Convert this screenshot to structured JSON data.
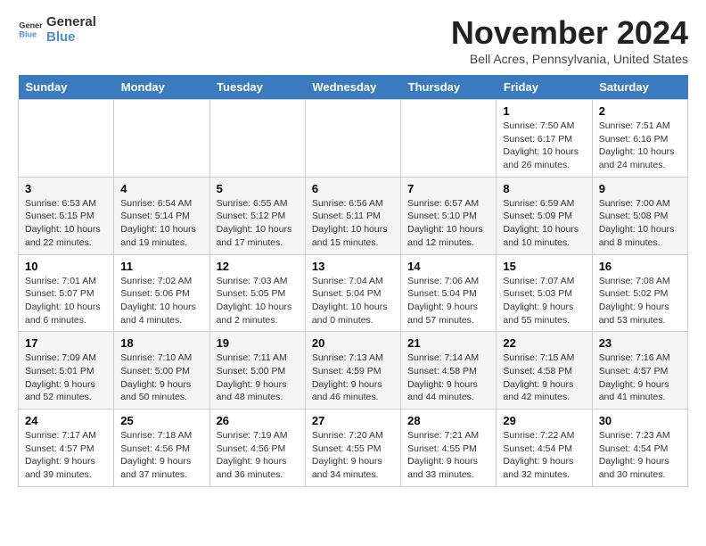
{
  "logo": {
    "text1": "General",
    "text2": "Blue"
  },
  "title": "November 2024",
  "subtitle": "Bell Acres, Pennsylvania, United States",
  "days_of_week": [
    "Sunday",
    "Monday",
    "Tuesday",
    "Wednesday",
    "Thursday",
    "Friday",
    "Saturday"
  ],
  "weeks": [
    [
      {
        "day": "",
        "info": ""
      },
      {
        "day": "",
        "info": ""
      },
      {
        "day": "",
        "info": ""
      },
      {
        "day": "",
        "info": ""
      },
      {
        "day": "",
        "info": ""
      },
      {
        "day": "1",
        "info": "Sunrise: 7:50 AM\nSunset: 6:17 PM\nDaylight: 10 hours\nand 26 minutes."
      },
      {
        "day": "2",
        "info": "Sunrise: 7:51 AM\nSunset: 6:16 PM\nDaylight: 10 hours\nand 24 minutes."
      }
    ],
    [
      {
        "day": "3",
        "info": "Sunrise: 6:53 AM\nSunset: 5:15 PM\nDaylight: 10 hours\nand 22 minutes."
      },
      {
        "day": "4",
        "info": "Sunrise: 6:54 AM\nSunset: 5:14 PM\nDaylight: 10 hours\nand 19 minutes."
      },
      {
        "day": "5",
        "info": "Sunrise: 6:55 AM\nSunset: 5:12 PM\nDaylight: 10 hours\nand 17 minutes."
      },
      {
        "day": "6",
        "info": "Sunrise: 6:56 AM\nSunset: 5:11 PM\nDaylight: 10 hours\nand 15 minutes."
      },
      {
        "day": "7",
        "info": "Sunrise: 6:57 AM\nSunset: 5:10 PM\nDaylight: 10 hours\nand 12 minutes."
      },
      {
        "day": "8",
        "info": "Sunrise: 6:59 AM\nSunset: 5:09 PM\nDaylight: 10 hours\nand 10 minutes."
      },
      {
        "day": "9",
        "info": "Sunrise: 7:00 AM\nSunset: 5:08 PM\nDaylight: 10 hours\nand 8 minutes."
      }
    ],
    [
      {
        "day": "10",
        "info": "Sunrise: 7:01 AM\nSunset: 5:07 PM\nDaylight: 10 hours\nand 6 minutes."
      },
      {
        "day": "11",
        "info": "Sunrise: 7:02 AM\nSunset: 5:06 PM\nDaylight: 10 hours\nand 4 minutes."
      },
      {
        "day": "12",
        "info": "Sunrise: 7:03 AM\nSunset: 5:05 PM\nDaylight: 10 hours\nand 2 minutes."
      },
      {
        "day": "13",
        "info": "Sunrise: 7:04 AM\nSunset: 5:04 PM\nDaylight: 10 hours\nand 0 minutes."
      },
      {
        "day": "14",
        "info": "Sunrise: 7:06 AM\nSunset: 5:04 PM\nDaylight: 9 hours\nand 57 minutes."
      },
      {
        "day": "15",
        "info": "Sunrise: 7:07 AM\nSunset: 5:03 PM\nDaylight: 9 hours\nand 55 minutes."
      },
      {
        "day": "16",
        "info": "Sunrise: 7:08 AM\nSunset: 5:02 PM\nDaylight: 9 hours\nand 53 minutes."
      }
    ],
    [
      {
        "day": "17",
        "info": "Sunrise: 7:09 AM\nSunset: 5:01 PM\nDaylight: 9 hours\nand 52 minutes."
      },
      {
        "day": "18",
        "info": "Sunrise: 7:10 AM\nSunset: 5:00 PM\nDaylight: 9 hours\nand 50 minutes."
      },
      {
        "day": "19",
        "info": "Sunrise: 7:11 AM\nSunset: 5:00 PM\nDaylight: 9 hours\nand 48 minutes."
      },
      {
        "day": "20",
        "info": "Sunrise: 7:13 AM\nSunset: 4:59 PM\nDaylight: 9 hours\nand 46 minutes."
      },
      {
        "day": "21",
        "info": "Sunrise: 7:14 AM\nSunset: 4:58 PM\nDaylight: 9 hours\nand 44 minutes."
      },
      {
        "day": "22",
        "info": "Sunrise: 7:15 AM\nSunset: 4:58 PM\nDaylight: 9 hours\nand 42 minutes."
      },
      {
        "day": "23",
        "info": "Sunrise: 7:16 AM\nSunset: 4:57 PM\nDaylight: 9 hours\nand 41 minutes."
      }
    ],
    [
      {
        "day": "24",
        "info": "Sunrise: 7:17 AM\nSunset: 4:57 PM\nDaylight: 9 hours\nand 39 minutes."
      },
      {
        "day": "25",
        "info": "Sunrise: 7:18 AM\nSunset: 4:56 PM\nDaylight: 9 hours\nand 37 minutes."
      },
      {
        "day": "26",
        "info": "Sunrise: 7:19 AM\nSunset: 4:56 PM\nDaylight: 9 hours\nand 36 minutes."
      },
      {
        "day": "27",
        "info": "Sunrise: 7:20 AM\nSunset: 4:55 PM\nDaylight: 9 hours\nand 34 minutes."
      },
      {
        "day": "28",
        "info": "Sunrise: 7:21 AM\nSunset: 4:55 PM\nDaylight: 9 hours\nand 33 minutes."
      },
      {
        "day": "29",
        "info": "Sunrise: 7:22 AM\nSunset: 4:54 PM\nDaylight: 9 hours\nand 32 minutes."
      },
      {
        "day": "30",
        "info": "Sunrise: 7:23 AM\nSunset: 4:54 PM\nDaylight: 9 hours\nand 30 minutes."
      }
    ]
  ]
}
